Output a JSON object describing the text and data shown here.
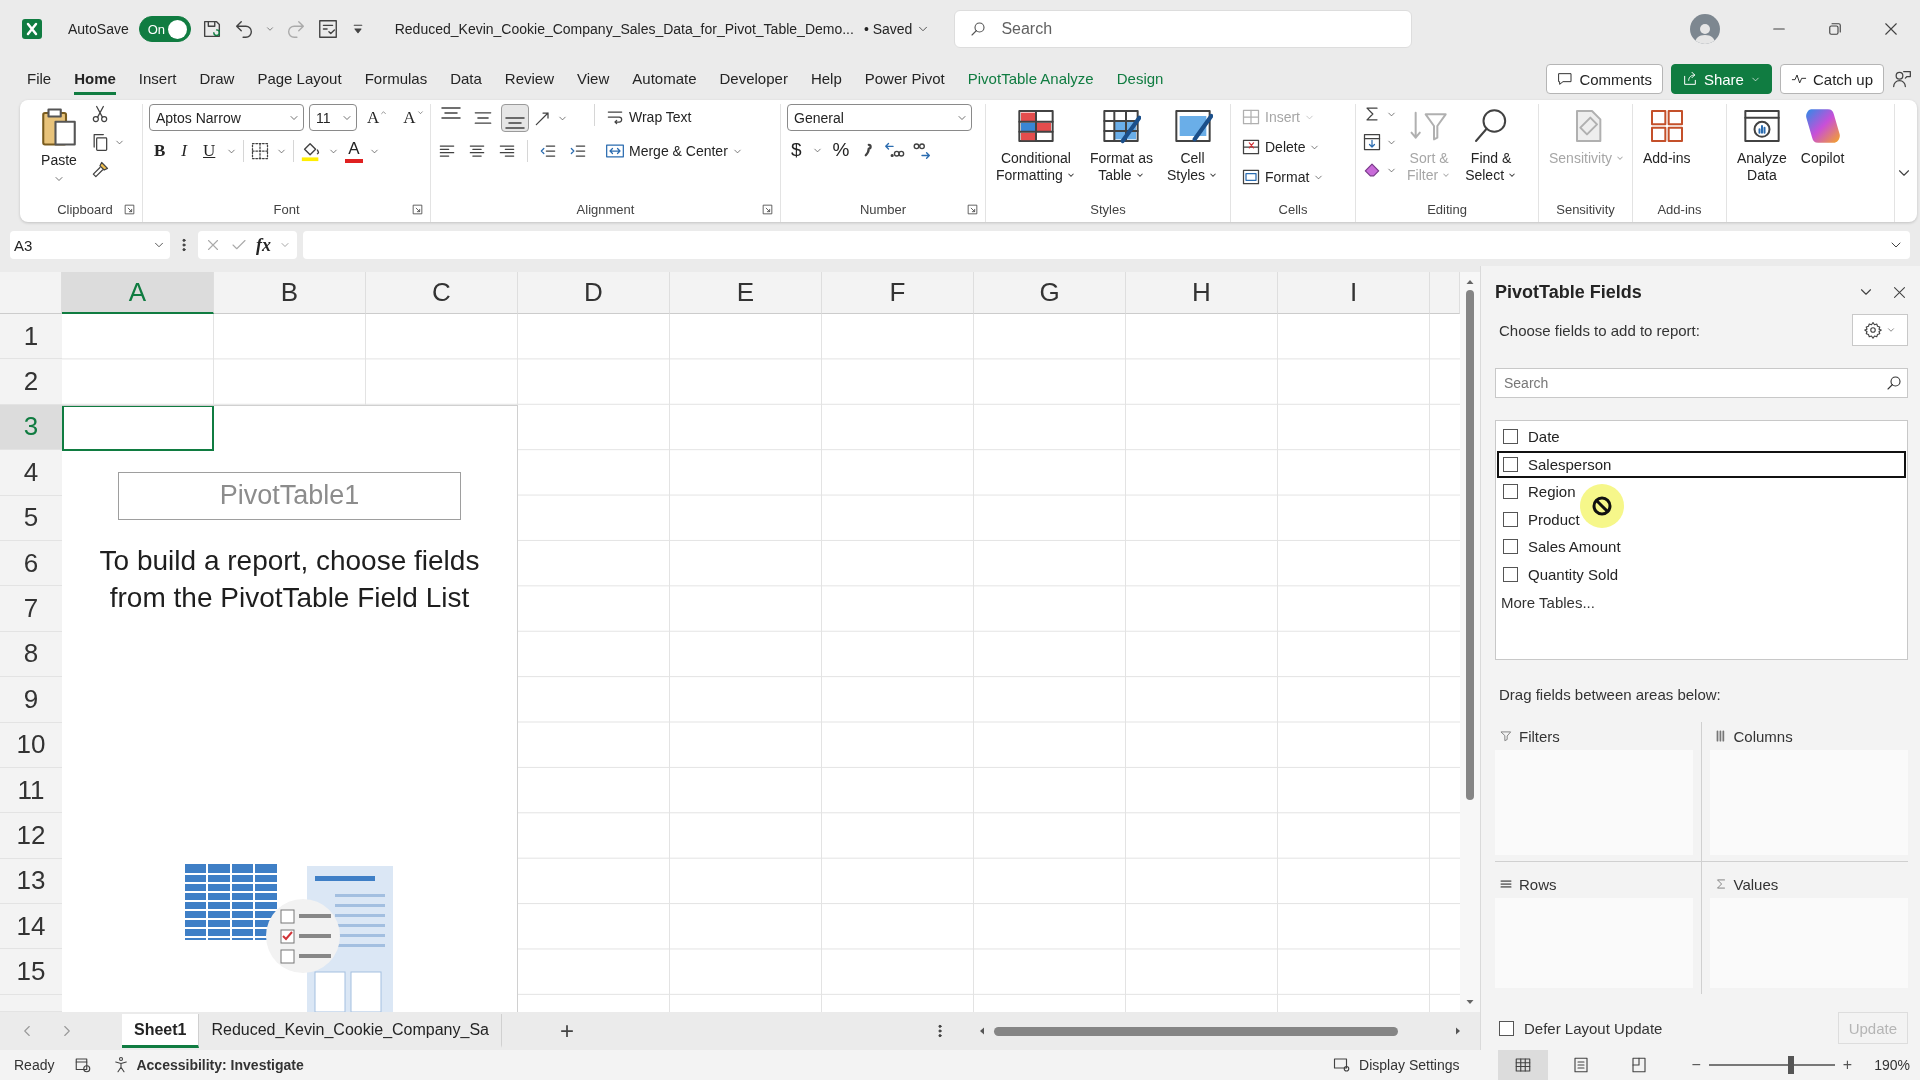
{
  "title_bar": {
    "autosave_label": "AutoSave",
    "autosave_on": true,
    "autosave_text": "On",
    "document_title": "Reduced_Kevin_Cookie_Company_Sales_Data_for_Pivot_Table_Demo...",
    "save_status": "• Saved",
    "search_placeholder": "Search"
  },
  "menu": {
    "tabs": [
      {
        "label": "File",
        "selected": false,
        "kind": "standard"
      },
      {
        "label": "Home",
        "selected": true,
        "kind": "standard"
      },
      {
        "label": "Insert",
        "selected": false,
        "kind": "standard"
      },
      {
        "label": "Draw",
        "selected": false,
        "kind": "standard"
      },
      {
        "label": "Page Layout",
        "selected": false,
        "kind": "standard"
      },
      {
        "label": "Formulas",
        "selected": false,
        "kind": "standard"
      },
      {
        "label": "Data",
        "selected": false,
        "kind": "standard"
      },
      {
        "label": "Review",
        "selected": false,
        "kind": "standard"
      },
      {
        "label": "View",
        "selected": false,
        "kind": "standard"
      },
      {
        "label": "Automate",
        "selected": false,
        "kind": "standard"
      },
      {
        "label": "Developer",
        "selected": false,
        "kind": "standard"
      },
      {
        "label": "Help",
        "selected": false,
        "kind": "standard"
      },
      {
        "label": "Power Pivot",
        "selected": false,
        "kind": "standard"
      },
      {
        "label": "PivotTable Analyze",
        "selected": false,
        "kind": "contextual"
      },
      {
        "label": "Design",
        "selected": false,
        "kind": "contextual"
      }
    ],
    "buttons": [
      {
        "label": "Comments",
        "kind": "comments"
      },
      {
        "label": "Share",
        "kind": "share"
      },
      {
        "label": "Catch up",
        "kind": "catch_up"
      }
    ]
  },
  "ribbon": {
    "groups": [
      {
        "kind": "clipboard",
        "name": "Clipboard",
        "launcher": true,
        "paste": "Paste"
      },
      {
        "kind": "font",
        "name": "Font",
        "launcher": true,
        "font_name": "Aptos Narrow",
        "font_size": "11",
        "grow": "A",
        "shrink": "A",
        "styles": [
          "B",
          "I",
          "U"
        ],
        "font_color": "A"
      },
      {
        "kind": "alignment",
        "name": "Alignment",
        "launcher": true,
        "vertical": [
          {
            "selected": false
          },
          {
            "selected": false
          },
          {
            "selected": true
          }
        ],
        "wrap": "Wrap Text",
        "merge": "Merge & Center"
      },
      {
        "kind": "number",
        "name": "Number",
        "launcher": true,
        "format": "General",
        "currency": "$",
        "percent": "%"
      },
      {
        "kind": "large",
        "name": "Styles",
        "buttons": [
          {
            "kind": "conditional_formatting",
            "lines": [
              "Conditional",
              "Formatting"
            ],
            "menu": true,
            "disabled": false
          },
          {
            "kind": "format_as_table",
            "lines": [
              "Format as",
              "Table"
            ],
            "menu": true,
            "disabled": false
          },
          {
            "kind": "cell_styles",
            "lines": [
              "Cell",
              "Styles"
            ],
            "menu": true,
            "disabled": false
          }
        ]
      },
      {
        "kind": "cells",
        "name": "Cells",
        "buttons": [
          {
            "kind": "insert",
            "label": "Insert",
            "disabled": true
          },
          {
            "kind": "delete",
            "label": "Delete",
            "disabled": false
          },
          {
            "kind": "format",
            "label": "Format",
            "disabled": false
          }
        ]
      },
      {
        "kind": "editing",
        "name": "Editing",
        "buttons": [
          {
            "kind": "sort_filter",
            "lines": [
              "Sort &",
              "Filter"
            ],
            "menu": true,
            "disabled": true
          },
          {
            "kind": "find_select",
            "lines": [
              "Find &",
              "Select"
            ],
            "menu": true,
            "disabled": false
          }
        ]
      },
      {
        "kind": "large",
        "name": "Sensitivity",
        "buttons": [
          {
            "kind": "sensitivity",
            "lines": [
              "Sensitivity"
            ],
            "menu": true,
            "disabled": true
          }
        ]
      },
      {
        "kind": "large",
        "name": "Add-ins",
        "buttons": [
          {
            "kind": "add_ins",
            "lines": [
              "Add-ins"
            ],
            "disabled": false
          }
        ]
      },
      {
        "kind": "large",
        "buttons": [
          {
            "kind": "analyze_data",
            "lines": [
              "Analyze",
              "Data"
            ],
            "disabled": false
          },
          {
            "kind": "copilot",
            "lines": [
              "Copilot"
            ],
            "disabled": false
          }
        ]
      }
    ]
  },
  "formula_bar": {
    "name_box": "A3",
    "fx": "fx"
  },
  "grid": {
    "columns": [
      {
        "label": "A",
        "selected": true
      },
      {
        "label": "B",
        "selected": false
      },
      {
        "label": "C",
        "selected": false
      },
      {
        "label": "D",
        "selected": false
      },
      {
        "label": "E",
        "selected": false
      },
      {
        "label": "F",
        "selected": false
      },
      {
        "label": "G",
        "selected": false
      },
      {
        "label": "H",
        "selected": false
      },
      {
        "label": "I",
        "selected": false
      }
    ],
    "rows": [
      {
        "label": "1",
        "selected": false
      },
      {
        "label": "2",
        "selected": false
      },
      {
        "label": "3",
        "selected": true
      },
      {
        "label": "4",
        "selected": false
      },
      {
        "label": "5",
        "selected": false
      },
      {
        "label": "6",
        "selected": false
      },
      {
        "label": "7",
        "selected": false
      },
      {
        "label": "8",
        "selected": false
      },
      {
        "label": "9",
        "selected": false
      },
      {
        "label": "10",
        "selected": false
      },
      {
        "label": "11",
        "selected": false
      },
      {
        "label": "12",
        "selected": false
      },
      {
        "label": "13",
        "selected": false
      },
      {
        "label": "14",
        "selected": false
      },
      {
        "label": "15",
        "selected": false
      }
    ],
    "pivot": {
      "name": "PivotTable1",
      "message": "To build a report, choose fields from the PivotTable Field List"
    }
  },
  "sheet_tabs": {
    "tabs": [
      {
        "label": "Sheet1",
        "selected": true
      },
      {
        "label": "Reduced_Kevin_Cookie_Company_Sa",
        "selected": false
      }
    ],
    "add": "+"
  },
  "pivot_pane": {
    "title": "PivotTable Fields",
    "subtitle": "Choose fields to add to report:",
    "search_placeholder": "Search",
    "fields": [
      {
        "label": "Date",
        "checked": false,
        "selected": false
      },
      {
        "label": "Salesperson",
        "checked": false,
        "selected": true
      },
      {
        "label": "Region",
        "checked": false,
        "selected": false
      },
      {
        "label": "Product",
        "checked": false,
        "selected": false
      },
      {
        "label": "Sales Amount",
        "checked": false,
        "selected": false
      },
      {
        "label": "Quantity Sold",
        "checked": false,
        "selected": false
      }
    ],
    "more_tables": "More Tables...",
    "drag_label": "Drag fields between areas below:",
    "areas": [
      {
        "label": "Filters",
        "kind": "filters"
      },
      {
        "label": "Columns",
        "kind": "columns"
      },
      {
        "label": "Rows",
        "kind": "rows"
      },
      {
        "label": "Values",
        "kind": "values"
      }
    ],
    "defer": {
      "label": "Defer Layout Update",
      "checked": false
    },
    "update": {
      "label": "Update",
      "disabled": true
    }
  },
  "status_bar": {
    "ready": "Ready",
    "accessibility": "Accessibility: Investigate",
    "display_settings": "Display Settings",
    "views": [
      {
        "kind": "normal",
        "selected": true
      },
      {
        "kind": "page_layout",
        "selected": false
      },
      {
        "kind": "page_break",
        "selected": false
      }
    ],
    "zoom_out": "−",
    "zoom_in": "+",
    "zoom": {
      "level": 0.65
    },
    "zoom_text": "190%"
  }
}
